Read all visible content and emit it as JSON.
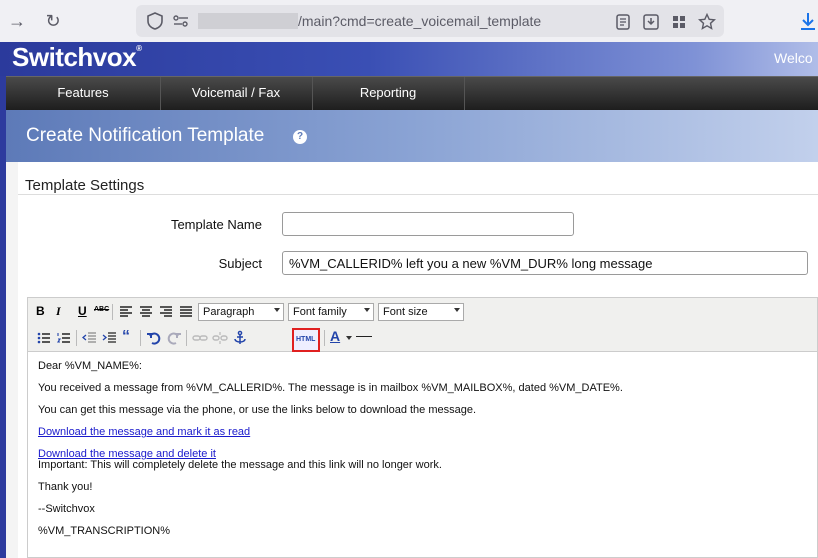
{
  "browser": {
    "url_text": "/main?cmd=create_voicemail_template"
  },
  "header": {
    "brand": "Switchvox",
    "trademark": "®",
    "welcome": "Welco"
  },
  "nav": {
    "items": [
      {
        "label": "Features"
      },
      {
        "label": "Voicemail / Fax"
      },
      {
        "label": "Reporting"
      }
    ]
  },
  "page": {
    "title": "Create Notification Template",
    "help": "?"
  },
  "settings": {
    "section_title": "Template Settings",
    "name_label": "Template Name",
    "name_value": "",
    "subject_label": "Subject",
    "subject_value": "%VM_CALLERID% left you a new %VM_DUR% long message"
  },
  "toolbar": {
    "bold": "B",
    "italic": "I",
    "underline": "U",
    "strike": "ABC",
    "format_select": "Paragraph",
    "font_family_select": "Font family",
    "font_size_select": "Font size",
    "html_button": "HTML",
    "text_color": "A"
  },
  "editor": {
    "lines": [
      "Dear %VM_NAME%:",
      "You received a message from %VM_CALLERID%. The message is in mailbox %VM_MAILBOX%, dated %VM_DATE%.",
      "You can get this message via the phone, or use the links below to download the message.",
      "Download the message and mark it as read",
      "Download the message and delete it",
      "Important: This will completely delete the message and this link will no longer work.",
      "Thank you!",
      "--Switchvox",
      "%VM_TRANSCRIPTION%"
    ]
  },
  "colors": {
    "brand_blue": "#2b3a9c",
    "nav_dark": "#1e1e1e",
    "title_blue": "#5d7ab8",
    "highlight_red": "#e02020",
    "link": "#1a1acc"
  }
}
